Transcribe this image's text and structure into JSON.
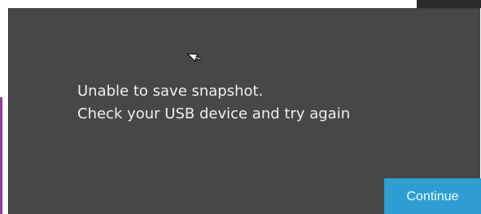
{
  "dialog": {
    "message_line1": "Unable to save snapshot.",
    "message_line2": "Check your USB device and try again",
    "continue_label": "Continue"
  },
  "colors": {
    "dialog_background": "#474747",
    "button_accent": "#2f9fd3",
    "text": "#eeeeee",
    "left_strip_accent": "#8e3a9e"
  },
  "icons": {
    "cursor": "mouse-pointer-icon"
  }
}
